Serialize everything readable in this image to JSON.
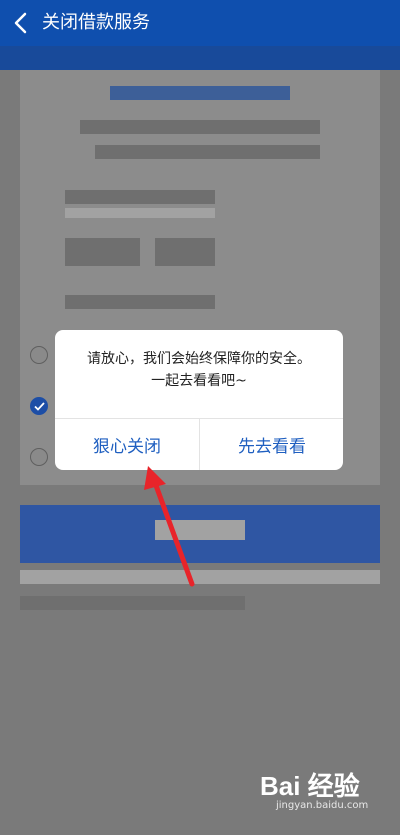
{
  "header": {
    "title": "关闭借款服务",
    "back_icon": "chevron-left-icon"
  },
  "dialog": {
    "message_line1": "请放心，我们会始终保障你的安全。",
    "message_line2": "一起去看看吧~",
    "cancel_label": "狠心关闭",
    "confirm_label": "先去看看"
  },
  "options": [
    {
      "checked": false
    },
    {
      "checked": true
    },
    {
      "checked": false
    }
  ],
  "watermark": {
    "brand": "Bai 经验",
    "url": "jingyan.baidu.com"
  },
  "colors": {
    "header": "#0f4fae",
    "accent": "#1f5fc0",
    "arrow": "#e8242a"
  }
}
